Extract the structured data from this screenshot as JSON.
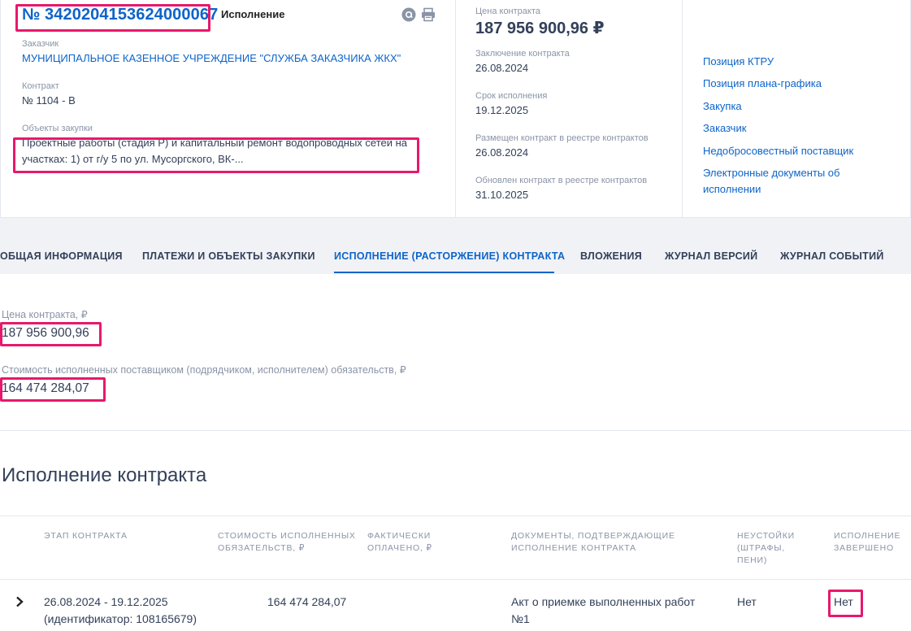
{
  "header": {
    "reg_number": "№ 3420204153624000067",
    "status": "Исполнение",
    "customer_label": "Заказчик",
    "customer_value": "МУНИЦИПАЛЬНОЕ КАЗЕННОЕ УЧРЕЖДЕНИЕ \"СЛУЖБА ЗАКАЗЧИКА ЖКХ\"",
    "contract_label": "Контракт",
    "contract_value": "№ 1104 - В",
    "objects_label": "Объекты закупки",
    "objects_line1": "Проектные работы (стадия Р) и капитальный ремонт водопроводных сетей на",
    "objects_line2": "участках: 1) от г/у 5 по ул. Мусоргского, ВК-..."
  },
  "summary": {
    "price_label": "Цена контракта",
    "price_value": "187 956 900,96 ₽",
    "conclusion_label": "Заключение контракта",
    "conclusion_value": "26.08.2024",
    "term_label": "Срок исполнения",
    "term_value": "19.12.2025",
    "placed_label": "Размещен контракт в реестре контрактов",
    "placed_value": "26.08.2024",
    "updated_label": "Обновлен контракт в реестре контрактов",
    "updated_value": "31.10.2025"
  },
  "links": [
    "Позиция КТРУ",
    "Позиция плана-графика",
    "Закупка",
    "Заказчик",
    "Недобросовестный поставщик",
    "Электронные документы об",
    "исполнении"
  ],
  "tabs": [
    "ОБЩАЯ ИНФОРМАЦИЯ",
    "ПЛАТЕЖИ И ОБЪЕКТЫ ЗАКУПКИ",
    "ИСПОЛНЕНИЕ (РАСТОРЖЕНИЕ) КОНТРАКТА",
    "ВЛОЖЕНИЯ",
    "ЖУРНАЛ ВЕРСИЙ",
    "ЖУРНАЛ СОБЫТИЙ"
  ],
  "execution": {
    "price_label": "Цена контракта, ₽",
    "price_value": "187 956 900,96",
    "cost_label": "Стоимость исполненных поставщиком (подрядчиком, исполнителем) обязательств, ₽",
    "cost_value": "164 474 284,07",
    "section_title": "Исполнение контракта"
  },
  "table": {
    "headers": {
      "stage": [
        "ЭТАП КОНТРАКТА"
      ],
      "cost": [
        "СТОИМОСТЬ ИСПОЛНЕННЫХ",
        "ОБЯЗАТЕЛЬСТВ, ₽"
      ],
      "paid": [
        "ФАКТИЧЕСКИ",
        "ОПЛАЧЕНО, ₽"
      ],
      "docs": [
        "ДОКУМЕНТЫ, ПОДТВЕРЖДАЮЩИЕ",
        "ИСПОЛНЕНИЕ КОНТРАКТА"
      ],
      "penalty": [
        "НЕУСТОЙКИ",
        "(ШТРАФЫ,",
        "ПЕНИ)"
      ],
      "done": [
        "ИСПОЛНЕНИЕ",
        "ЗАВЕРШЕНО"
      ]
    },
    "row": {
      "stage_line1": "26.08.2024 - 19.12.2025",
      "stage_line2": "(идентификатор: 108165679)",
      "cost": "164 474 284,07",
      "docs_line1": "Акт о приемке выполненных работ",
      "docs_line2": "№1",
      "penalty": "Нет",
      "done": "Нет"
    }
  },
  "colors": {
    "accent": "#0d64c9",
    "highlight": "#e8186c",
    "text": "#334059",
    "muted": "#8a94a6"
  }
}
